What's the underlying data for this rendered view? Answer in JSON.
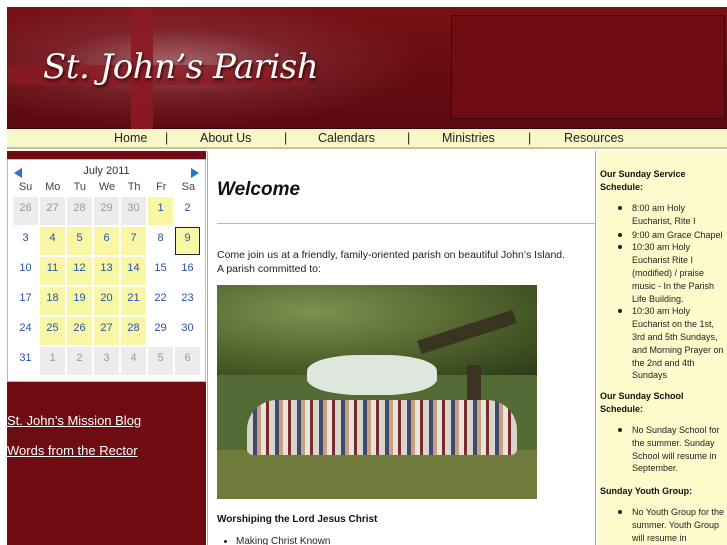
{
  "header": {
    "site_title": "St. John’s Parish"
  },
  "nav": {
    "items": [
      "Home",
      "About Us",
      "Calendars",
      "Ministries",
      "Resources"
    ],
    "separator": "|"
  },
  "calendar": {
    "month_title": "July 2011",
    "prev_icon": "arrow-left-icon",
    "next_icon": "arrow-right-icon",
    "weekdays": [
      "Su",
      "Mo",
      "Tu",
      "We",
      "Th",
      "Fr",
      "Sa"
    ],
    "days": [
      {
        "d": "26",
        "t": "other"
      },
      {
        "d": "27",
        "t": "other"
      },
      {
        "d": "28",
        "t": "other"
      },
      {
        "d": "29",
        "t": "other"
      },
      {
        "d": "30",
        "t": "other"
      },
      {
        "d": "1",
        "t": "event"
      },
      {
        "d": "2",
        "t": "plain"
      },
      {
        "d": "3",
        "t": "plain"
      },
      {
        "d": "4",
        "t": "event"
      },
      {
        "d": "5",
        "t": "event"
      },
      {
        "d": "6",
        "t": "event"
      },
      {
        "d": "7",
        "t": "event"
      },
      {
        "d": "8",
        "t": "plain"
      },
      {
        "d": "9",
        "t": "today"
      },
      {
        "d": "10",
        "t": "plain"
      },
      {
        "d": "11",
        "t": "event"
      },
      {
        "d": "12",
        "t": "event"
      },
      {
        "d": "13",
        "t": "event"
      },
      {
        "d": "14",
        "t": "event"
      },
      {
        "d": "15",
        "t": "plain"
      },
      {
        "d": "16",
        "t": "plain"
      },
      {
        "d": "17",
        "t": "plain"
      },
      {
        "d": "18",
        "t": "event"
      },
      {
        "d": "19",
        "t": "event"
      },
      {
        "d": "20",
        "t": "event"
      },
      {
        "d": "21",
        "t": "event"
      },
      {
        "d": "22",
        "t": "plain"
      },
      {
        "d": "23",
        "t": "plain"
      },
      {
        "d": "24",
        "t": "plain"
      },
      {
        "d": "25",
        "t": "event"
      },
      {
        "d": "26",
        "t": "event"
      },
      {
        "d": "27",
        "t": "event"
      },
      {
        "d": "28",
        "t": "event"
      },
      {
        "d": "29",
        "t": "plain"
      },
      {
        "d": "30",
        "t": "plain"
      },
      {
        "d": "31",
        "t": "plain"
      },
      {
        "d": "1",
        "t": "other"
      },
      {
        "d": "2",
        "t": "other"
      },
      {
        "d": "3",
        "t": "other"
      },
      {
        "d": "4",
        "t": "other"
      },
      {
        "d": "5",
        "t": "other"
      },
      {
        "d": "6",
        "t": "other"
      }
    ]
  },
  "sidebar_links": {
    "mission_blog": "St. John’s Mission Blog",
    "rector": "Words from the Rector"
  },
  "main": {
    "heading": "Welcome",
    "intro_line1": "Come join us at a friendly, family-oriented parish on beautiful John’s Island.",
    "intro_line2": "A parish committed to:",
    "worship_heading": "Worshiping the Lord Jesus Christ",
    "mission_items": [
      "Making Christ Known"
    ]
  },
  "right": {
    "service_heading": "Our Sunday Service Schedule:",
    "service_items": [
      "8:00 am Holy Eucharist, Rite I",
      "9:00 am Grace Chapel",
      "10:30 am Holy Eucharist Rite I (modified) / praise music - In the Parish Life Building.",
      "10:30 am Holy Eucharist on the 1st, 3rd and 5th Sundays, and Morning Prayer on the 2nd and 4th Sundays"
    ],
    "school_heading": "Our Sunday School Schedule:",
    "school_items": [
      "No Sunday School for the summer. Sunday School will resume in September."
    ],
    "youth_heading": "Sunday Youth Group:",
    "youth_items": [
      "No Youth Group for the summer. Youth Group will resume in"
    ]
  },
  "colors": {
    "header_maroon": "#6e0c12",
    "nav_yellow": "#f9f6c8",
    "event_yellow": "#f9f6a6",
    "link_blue": "#2653a6",
    "sidebar_cream": "#fdfbcc"
  }
}
